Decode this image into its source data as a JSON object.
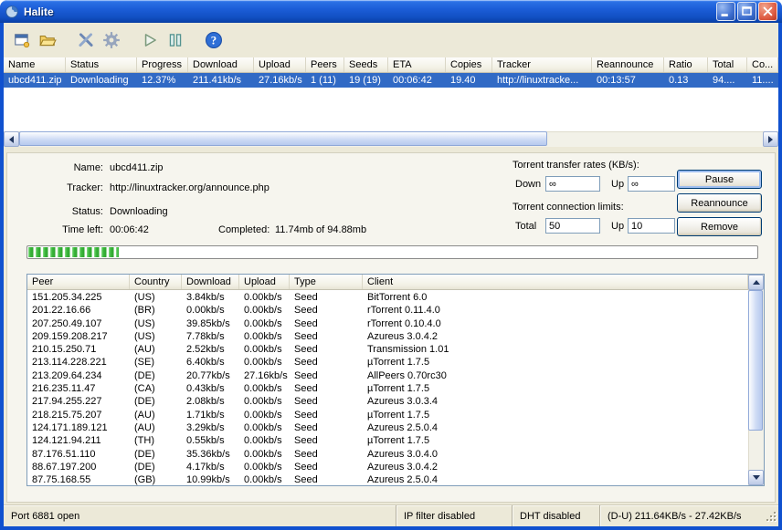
{
  "window": {
    "title": "Halite"
  },
  "toolbar": {
    "icons": [
      "new-torrent",
      "open-torrent",
      "torrent-tools",
      "preferences",
      "resume",
      "pause-torrent",
      "help"
    ]
  },
  "torrent_table": {
    "columns": [
      "Name",
      "Status",
      "Progress",
      "Download",
      "Upload",
      "Peers",
      "Seeds",
      "ETA",
      "Copies",
      "Tracker",
      "Reannounce",
      "Ratio",
      "Total",
      "Co..."
    ],
    "selected_index": 0,
    "rows": [
      [
        "ubcd411.zip",
        "Downloading",
        "12.37%",
        "211.41kb/s",
        "27.16kb/s",
        "1 (11)",
        "19 (19)",
        "00:06:42",
        "19.40",
        "http://linuxtracke...",
        "00:13:57",
        "0.13",
        "94....",
        "11...."
      ]
    ]
  },
  "details": {
    "name_label": "Name:",
    "name_value": "ubcd411.zip",
    "tracker_label": "Tracker:",
    "tracker_value": "http://linuxtracker.org/announce.php",
    "status_label": "Status:",
    "status_value": "Downloading",
    "time_left_label": "Time left:",
    "time_left_value": "00:06:42",
    "completed_label": "Completed:",
    "completed_value": "11.74mb of 94.88mb",
    "progress_percent": "12.37"
  },
  "transfer": {
    "rates_title": "Torrent transfer rates (KB/s):",
    "down_label": "Down",
    "down_value": "∞",
    "up_label": "Up",
    "up_value": "∞",
    "limits_title": "Torrent connection limits:",
    "total_label": "Total",
    "total_value": "50",
    "up_limit_label": "Up",
    "up_limit_value": "10"
  },
  "actions": {
    "pause": "Pause",
    "reannounce": "Reannounce",
    "remove": "Remove"
  },
  "peers_table": {
    "columns": [
      "Peer",
      "Country",
      "Download",
      "Upload",
      "Type",
      "Client"
    ],
    "rows": [
      [
        "151.205.34.225",
        "(US)",
        "3.84kb/s",
        "0.00kb/s",
        "Seed",
        "BitTorrent 6.0"
      ],
      [
        "201.22.16.66",
        "(BR)",
        "0.00kb/s",
        "0.00kb/s",
        "Seed",
        "rTorrent 0.11.4.0"
      ],
      [
        "207.250.49.107",
        "(US)",
        "39.85kb/s",
        "0.00kb/s",
        "Seed",
        "rTorrent 0.10.4.0"
      ],
      [
        "209.159.208.217",
        "(US)",
        "7.78kb/s",
        "0.00kb/s",
        "Seed",
        "Azureus 3.0.4.2"
      ],
      [
        "210.15.250.71",
        "(AU)",
        "2.52kb/s",
        "0.00kb/s",
        "Seed",
        "Transmission 1.01"
      ],
      [
        "213.114.228.221",
        "(SE)",
        "6.40kb/s",
        "0.00kb/s",
        "Seed",
        "µTorrent 1.7.5"
      ],
      [
        "213.209.64.234",
        "(DE)",
        "20.77kb/s",
        "27.16kb/s",
        "Seed",
        "AllPeers 0.70rc30"
      ],
      [
        "216.235.11.47",
        "(CA)",
        "0.43kb/s",
        "0.00kb/s",
        "Seed",
        "µTorrent 1.7.5"
      ],
      [
        "217.94.255.227",
        "(DE)",
        "2.08kb/s",
        "0.00kb/s",
        "Seed",
        "Azureus 3.0.3.4"
      ],
      [
        "218.215.75.207",
        "(AU)",
        "1.71kb/s",
        "0.00kb/s",
        "Seed",
        "µTorrent 1.7.5"
      ],
      [
        "124.171.189.121",
        "(AU)",
        "3.29kb/s",
        "0.00kb/s",
        "Seed",
        "Azureus 2.5.0.4"
      ],
      [
        "124.121.94.211",
        "(TH)",
        "0.55kb/s",
        "0.00kb/s",
        "Seed",
        "µTorrent 1.7.5"
      ],
      [
        "87.176.51.110",
        "(DE)",
        "35.36kb/s",
        "0.00kb/s",
        "Seed",
        "Azureus 3.0.4.0"
      ],
      [
        "88.67.197.200",
        "(DE)",
        "4.17kb/s",
        "0.00kb/s",
        "Seed",
        "Azureus 3.0.4.2"
      ],
      [
        "87.75.168.55",
        "(GB)",
        "10.99kb/s",
        "0.00kb/s",
        "Seed",
        "Azureus 2.5.0.4"
      ]
    ]
  },
  "status_bar": {
    "port": "Port 6881 open",
    "ip_filter": "IP filter disabled",
    "dht": "DHT disabled",
    "rates": "(D-U) 211.64KB/s - 27.42KB/s"
  },
  "colors": {
    "selection": "#316ac5",
    "progress_green": "#3cb83c",
    "titlebar_blue": "#1250c4",
    "chrome_tan": "#ece9d8"
  }
}
